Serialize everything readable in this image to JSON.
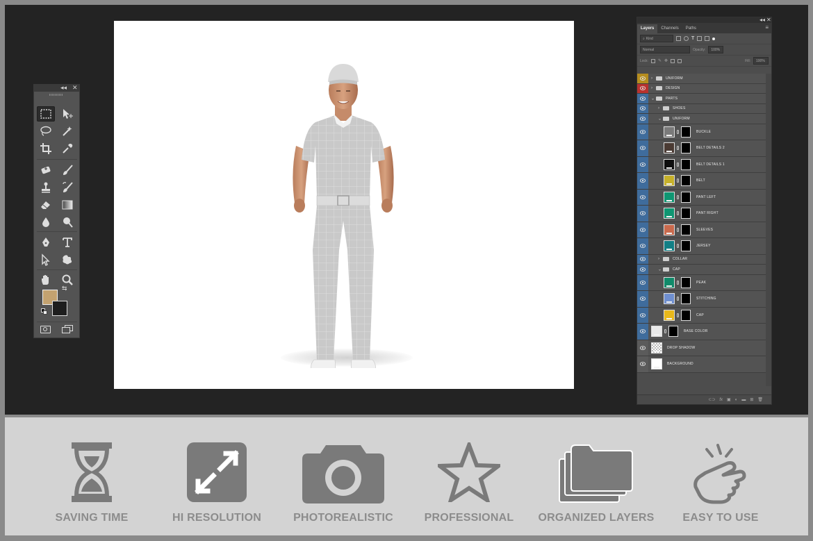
{
  "layers_panel": {
    "tabs": [
      "Layers",
      "Channels",
      "Paths"
    ],
    "filter_label": "Kind",
    "blend_mode": "Normal",
    "opacity_label": "Opacity:",
    "opacity_value": "100%",
    "lock_label": "Lock:",
    "fill_label": "Fill:",
    "fill_value": "100%",
    "layers": [
      {
        "name": "UNIFORM",
        "kind": "group",
        "indent": 0,
        "eye_color": "#b58d1f",
        "collapsed": true
      },
      {
        "name": "DESIGN",
        "kind": "group",
        "indent": 0,
        "eye_color": "#b8322f",
        "collapsed": true
      },
      {
        "name": "PARTS",
        "kind": "group",
        "indent": 0,
        "eye_color": "#3f6c9c",
        "collapsed": false
      },
      {
        "name": "SHOES",
        "kind": "group",
        "indent": 1,
        "eye_color": "#3f6c9c",
        "collapsed": true
      },
      {
        "name": "UNIFORM",
        "kind": "group",
        "indent": 1,
        "eye_color": "#3f6c9c",
        "collapsed": false
      },
      {
        "name": "BUCKLE",
        "kind": "color",
        "indent": 2,
        "eye_color": "#3f6c9c",
        "swatch": "#7a7a7a"
      },
      {
        "name": "BELT DETAILS 2",
        "kind": "color",
        "indent": 2,
        "eye_color": "#3f6c9c",
        "swatch": "#4a3a33"
      },
      {
        "name": "BELT DETAILS 1",
        "kind": "color",
        "indent": 2,
        "eye_color": "#3f6c9c",
        "swatch": "#0e0e0e"
      },
      {
        "name": "BELT",
        "kind": "color",
        "indent": 2,
        "eye_color": "#3f6c9c",
        "swatch": "#c6b12a"
      },
      {
        "name": "PANT LEFT",
        "kind": "color",
        "indent": 2,
        "eye_color": "#3f6c9c",
        "swatch": "#0f9672"
      },
      {
        "name": "PANT RIGHT",
        "kind": "color",
        "indent": 2,
        "eye_color": "#3f6c9c",
        "swatch": "#0f9672"
      },
      {
        "name": "SLEEVES",
        "kind": "color",
        "indent": 2,
        "eye_color": "#3f6c9c",
        "swatch": "#c96a4d"
      },
      {
        "name": "JERSEY",
        "kind": "color",
        "indent": 2,
        "eye_color": "#3f6c9c",
        "swatch": "#127f85"
      },
      {
        "name": "COLLAR",
        "kind": "group",
        "indent": 1,
        "eye_color": "#3f6c9c",
        "collapsed": true
      },
      {
        "name": "CAP",
        "kind": "group",
        "indent": 1,
        "eye_color": "#3f6c9c",
        "collapsed": false
      },
      {
        "name": "PEAK",
        "kind": "color",
        "indent": 2,
        "eye_color": "#3f6c9c",
        "swatch": "#108a6a"
      },
      {
        "name": "STITCHING",
        "kind": "color",
        "indent": 2,
        "eye_color": "#3f6c9c",
        "swatch": "#6f8fd0"
      },
      {
        "name": "CAP",
        "kind": "color",
        "indent": 2,
        "eye_color": "#3f6c9c",
        "swatch": "#e8b81a"
      },
      {
        "name": "BASE COLOR",
        "kind": "base",
        "indent": 0,
        "eye_color": "#3f6c9c",
        "swatch": "#e9e9e9"
      },
      {
        "name": "DROP SHADOW",
        "kind": "plain",
        "indent": 0,
        "eye_color": "#5b5b5b",
        "swatch": "checker"
      },
      {
        "name": "BACKGROUND",
        "kind": "plain",
        "indent": 0,
        "eye_color": "#5b5b5b",
        "swatch": "#ffffff"
      }
    ]
  },
  "tools": {
    "foreground_color": "#c3a270",
    "background_color": "#1e1e1e",
    "items": [
      "marquee-icon",
      "move-icon",
      "lasso-icon",
      "magic-wand-icon",
      "crop-icon",
      "eyedropper-icon",
      "healing-brush-icon",
      "brush-icon",
      "clone-stamp-icon",
      "history-brush-icon",
      "eraser-icon",
      "gradient-icon",
      "blur-icon",
      "dodge-icon",
      "pen-icon",
      "type-icon",
      "path-select-icon",
      "shape-icon",
      "hand-icon",
      "zoom-icon"
    ]
  },
  "features": [
    {
      "label": "SAVING TIME",
      "icon": "hourglass-icon"
    },
    {
      "label": "HI RESOLUTION",
      "icon": "expand-icon"
    },
    {
      "label": "PHOTOREALISTIC",
      "icon": "camera-icon"
    },
    {
      "label": "PROFESSIONAL",
      "icon": "star-icon"
    },
    {
      "label": "ORGANIZED LAYERS",
      "icon": "layers-folder-icon"
    },
    {
      "label": "EASY TO USE",
      "icon": "tap-hand-icon"
    }
  ],
  "colors": {
    "workspace": "#232323",
    "panel": "#535353",
    "feature_band": "#d3d3d3",
    "feature_text": "#8c8c8c"
  }
}
